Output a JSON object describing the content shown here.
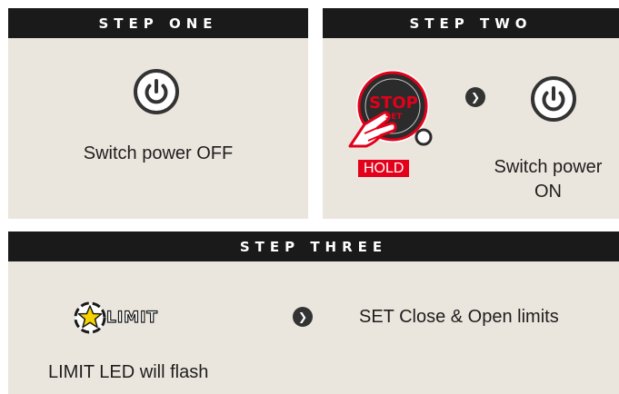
{
  "step_one": {
    "title": "STEP ONE",
    "icon": "power-icon",
    "text": "Switch power OFF"
  },
  "step_two": {
    "title": "STEP TWO",
    "button_text": "STOP",
    "button_subtext": "SET",
    "hold_label": "HOLD",
    "arrow_icon": "chevron-right-icon",
    "power_icon": "power-icon",
    "text_line1": "Switch power",
    "text_line2": "ON"
  },
  "step_three": {
    "title": "STEP THREE",
    "limit_label": "LIMIT",
    "arrow_icon": "chevron-right-icon",
    "instruction": "SET Close & Open limits",
    "note": "LIMIT LED will flash"
  },
  "colors": {
    "panel_bg": "#ebe6dd",
    "header_bg": "#1a1a1a",
    "accent_red": "#e2001a",
    "icon_dark": "#333333",
    "led_yellow": "#f5d200"
  }
}
